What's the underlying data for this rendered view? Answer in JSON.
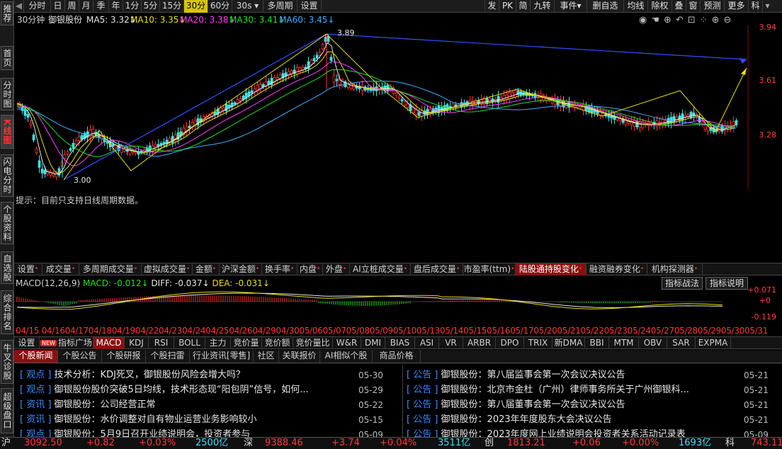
{
  "sidebar": {
    "items": [
      "推荐",
      "首页",
      "分时图",
      "K线图",
      "闪电分时",
      "个股资料",
      "自选股",
      "综合排名",
      "牛叉诊股",
      "超级盘口"
    ]
  },
  "toolbar": {
    "left": [
      "分时",
      "日",
      "周",
      "月",
      "季",
      "年",
      "1分",
      "5分",
      "15分",
      "30分",
      "60分",
      "30s",
      "多周期",
      "设置"
    ],
    "selected": "30分",
    "right": [
      "发",
      "PK",
      "简",
      "九转",
      "事件",
      "删自选",
      "均线",
      "除权",
      "叠",
      "窗",
      "预测",
      "更多",
      "科"
    ]
  },
  "quote": {
    "period": "30分钟",
    "name": "御银股份",
    "ma5": "MA5: 3.32↓",
    "ma10": "MA10: 3.35↓",
    "ma20": "MA20: 3.38↓",
    "ma30": "MA30: 3.41↓",
    "ma60": "MA60: 3.45↓"
  },
  "chart_data": {
    "type": "candlestick",
    "price_axis": [
      "3.94",
      "3.61",
      "3.28"
    ],
    "high_label": "3.89",
    "low_label": "3.00"
  },
  "hint": "提示：目前只支持日线周期数据。",
  "tabs1": [
    "设置",
    "成交量",
    "多周期成交量",
    "虚拟成交量",
    "金额",
    "沪深金额",
    "换手率",
    "内盘",
    "外盘",
    "AI立桩成交量",
    "盘后成交量",
    "市盈率(ttm)",
    "陆股通持股变化",
    "融资融券变化",
    "机构探测器"
  ],
  "tabs1_selected": "陆股通持股变化",
  "macd": {
    "title": "MACD(12,26,9)",
    "macd": "MACD: -0.012↓",
    "diff": "DIFF: -0.037↓",
    "dea": "DEA: -0.031↓",
    "axis": [
      "+0.071",
      "+0",
      "-0.119"
    ],
    "buttons": [
      "指标战法",
      "指标说明"
    ]
  },
  "dates": "04/15 04/1604/1704/1804/1904/2204/2304/2404/2504/2604/2904/3005/0605/0705/0805/0905/1005/1305/1405/1505/1605/1705/2005/2105/2205/2305/2405/2705/2805/2905/3005/31",
  "tabs2": [
    "设置",
    "指标广场",
    "MACD",
    "KDJ",
    "RSI",
    "BOLL",
    "主力",
    "竞价量",
    "竞价额",
    "竞价量比",
    "W&R",
    "DMI",
    "BIAS",
    "ASI",
    "VR",
    "ARBR",
    "DPO",
    "TRIX",
    "新DMA",
    "BBI",
    "MTM",
    "OBV",
    "SAR",
    "EXPMA"
  ],
  "tabs2_new": "NEW",
  "tabs2_selected": "MACD",
  "tabs3": [
    "个股新闻",
    "个股公告",
    "个股研报",
    "个股扫雷",
    "行业资讯[零售]",
    "社区",
    "关联报价",
    "AI相似个股",
    "商品价格"
  ],
  "tabs3_selected": "个股新闻",
  "news_left": [
    {
      "tag": "[ 观点 ]",
      "title": "技术分析：KDJ死叉，御银股份风险会增大吗？",
      "date": "05-30"
    },
    {
      "tag": "[ 观点 ]",
      "title": "御银股份股价突破5日均线，技术形态现“阳包阴”信号，如何...",
      "date": "05-29"
    },
    {
      "tag": "[ 资讯 ]",
      "title": "御银股份：公司经营正常",
      "date": "05-22"
    },
    {
      "tag": "[ 资讯 ]",
      "title": "御银股份：水价调整对自有物业运营业务影响较小",
      "date": "05-15"
    },
    {
      "tag": "[ 观点 ]",
      "title": "御银股份：5月9日召开业绩说明会，投资者参与",
      "date": "05-09"
    }
  ],
  "news_right": [
    {
      "tag": "[ 公告 ]",
      "title": "御银股份：第八届监事会第一次会议决议公告",
      "date": "05-21"
    },
    {
      "tag": "[ 公告 ]",
      "title": "御银股份：北京市金杜（广州）律师事务所关于广州御银科...",
      "date": "05-21"
    },
    {
      "tag": "[ 公告 ]",
      "title": "御银股份：第八届董事会第一次会议决议公告",
      "date": "05-21"
    },
    {
      "tag": "[ 公告 ]",
      "title": "御银股份：2023年年度股东大会决议公告",
      "date": "05-21"
    },
    {
      "tag": "[ 公告 ]",
      "title": "御银股份：2023年度网上业绩说明会投资者关系活动记录表",
      "date": "05-09"
    }
  ],
  "status": {
    "sh_label": "沪",
    "sh_index": "3092.50",
    "sh_chg": "+0.82",
    "sh_pct": "+0.03%",
    "sh_amt": "2500亿",
    "sz_label": "深",
    "sz_index": "9388.46",
    "sz_chg": "+3.74",
    "sz_pct": "+0.04%",
    "sz_amt": "3511亿",
    "cy_label": "创",
    "cy_index": "1813.21",
    "cy_chg": "+0.06",
    "cy_pct": "+0.00%",
    "cy_amt": "1693亿",
    "ke_label": "科",
    "ke_index": "743.11"
  }
}
